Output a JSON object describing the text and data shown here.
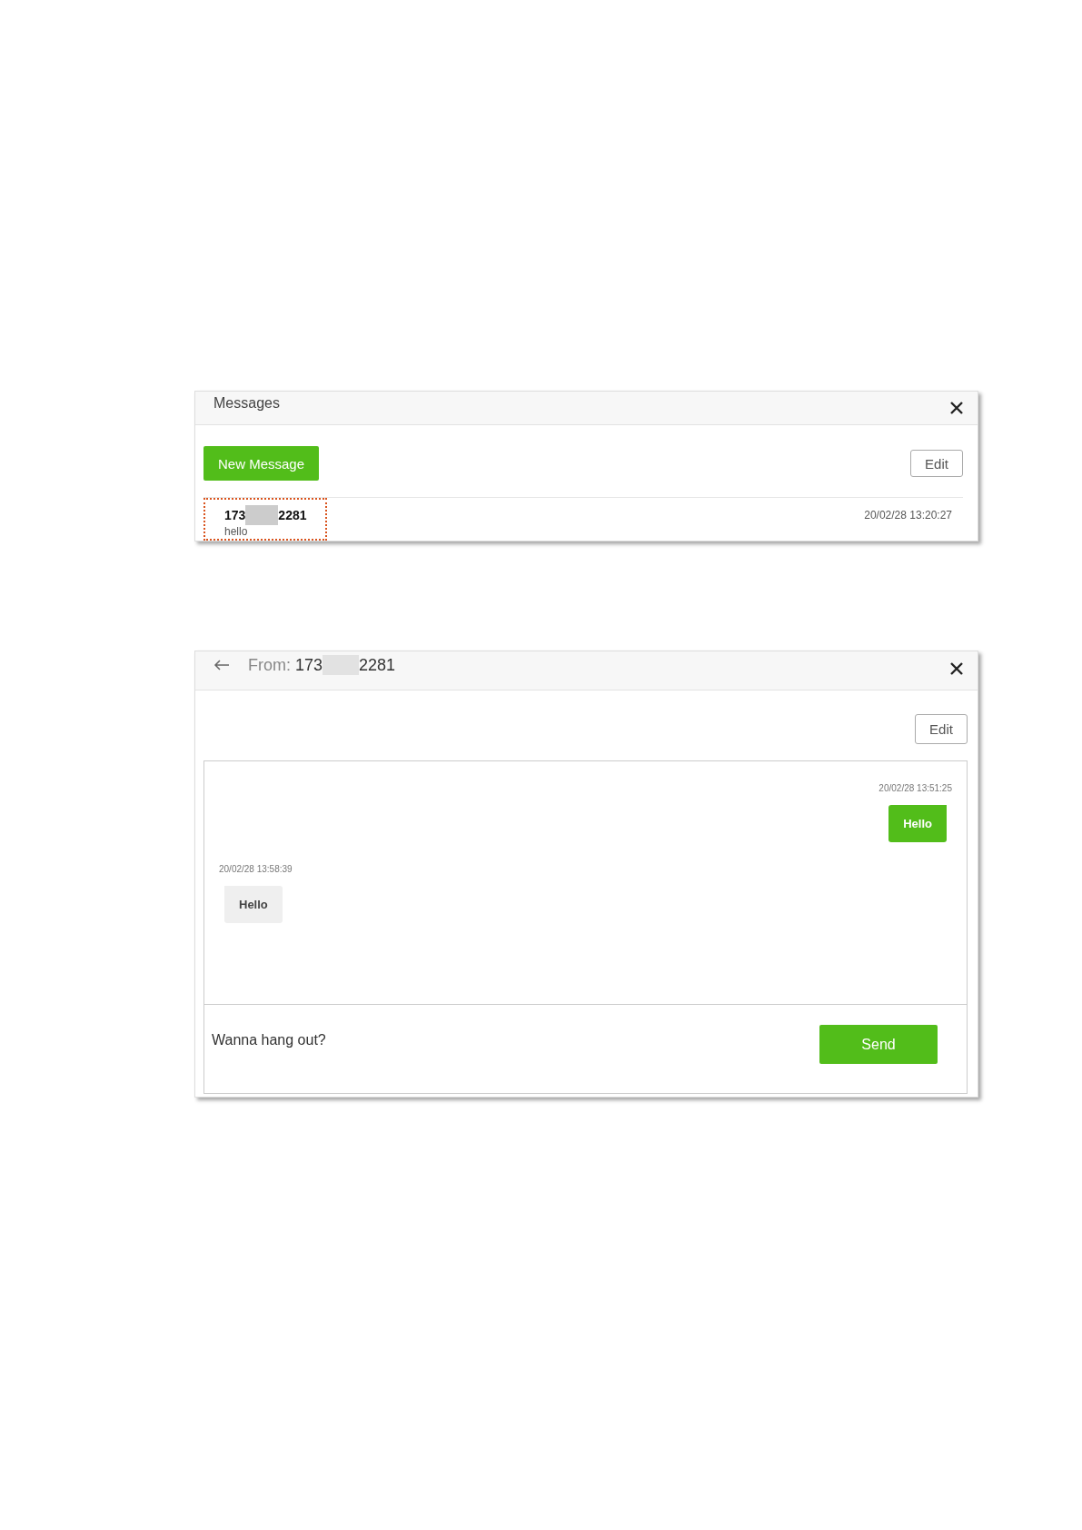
{
  "messages_window": {
    "title": "Messages",
    "new_message_button": "New Message",
    "edit_button": "Edit",
    "conversations": [
      {
        "number_start": "173",
        "number_end": "2281",
        "preview": "hello",
        "time": "20/02/28 13:20:27",
        "highlighted": true
      }
    ]
  },
  "conversation_window": {
    "title_label": "From:",
    "number_start": "173",
    "number_end": "2281",
    "edit_button": "Edit",
    "messages": [
      {
        "kind": "sent",
        "time": "20/02/28 13:51:25",
        "text": "Hello"
      },
      {
        "kind": "received",
        "time": "20/02/28 13:58:39",
        "text": "Hello"
      }
    ],
    "input": {
      "value": "Wanna hang out?"
    },
    "send_button": "Send"
  }
}
